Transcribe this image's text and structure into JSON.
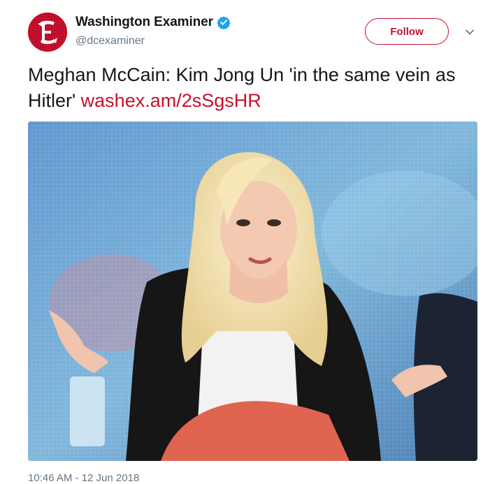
{
  "account": {
    "display_name": "Washington Examiner",
    "handle": "@dcexaminer",
    "verified": true,
    "avatar_icon": "gothic-letter-e-logo",
    "avatar_color": "#c8102e"
  },
  "follow_button": {
    "label": "Follow"
  },
  "menu": {
    "icon": "chevron-down-icon"
  },
  "tweet": {
    "text": "Meghan McCain: Kim Jong Un 'in the same vein as Hitler' ",
    "link": "washex.am/2sSgsHR"
  },
  "media": {
    "alt": "Photo of a blonde woman in a black leather jacket gesturing with both hands on a TV panel stage"
  },
  "meta": {
    "timestamp": "10:46 AM - 12 Jun 2018"
  },
  "colors": {
    "accent": "#c8102e",
    "text": "#14171a",
    "secondary": "#657786",
    "verified": "#1da1f2"
  }
}
